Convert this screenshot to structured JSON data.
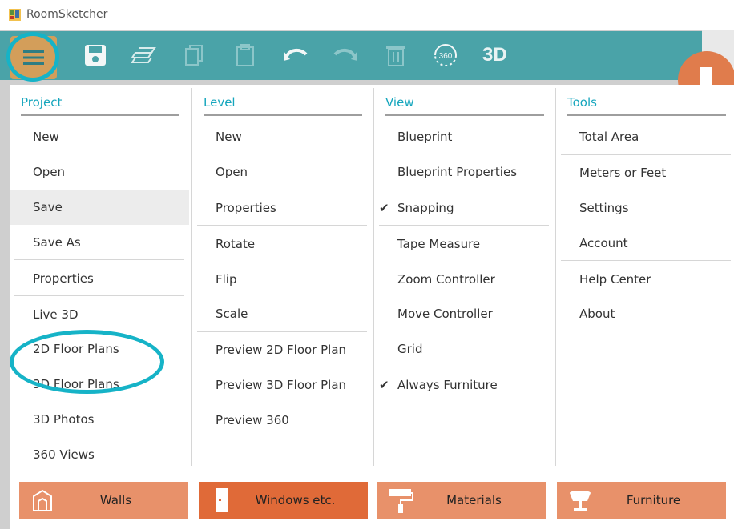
{
  "window": {
    "title": "RoomSketcher"
  },
  "toolbar": {
    "menu_icon": "hamburger-menu-icon",
    "save_icon": "floppy-save-icon",
    "layers_icon": "layers-icon",
    "copy_icon": "copy-icon",
    "paste_icon": "clipboard-paste-icon",
    "undo_icon": "undo-arrow-icon",
    "redo_icon": "redo-arrow-icon",
    "delete_icon": "trash-icon",
    "rotate360_label": "360",
    "view3d_label": "3D",
    "accent_color": "#4aa3a8",
    "menu_button_color": "#d39e5a"
  },
  "menu": {
    "project": {
      "header": "Project",
      "items": [
        "New",
        "Open",
        "Save",
        "Save As",
        "Properties",
        "Live 3D",
        "2D Floor Plans",
        "3D Floor Plans",
        "3D Photos",
        "360 Views"
      ],
      "selected": "Save"
    },
    "level": {
      "header": "Level",
      "items": [
        "New",
        "Open",
        "Properties",
        "Rotate",
        "Flip",
        "Scale",
        "Preview 2D Floor Plan",
        "Preview 3D Floor Plan",
        "Preview 360"
      ]
    },
    "view": {
      "header": "View",
      "items": [
        "Blueprint",
        "Blueprint Properties",
        "Snapping",
        "Tape Measure",
        "Zoom Controller",
        "Move Controller",
        "Grid",
        "Always Furniture"
      ],
      "checked": [
        "Snapping",
        "Always Furniture"
      ],
      "check_glyph": "✔"
    },
    "tools": {
      "header": "Tools",
      "items": [
        "Total Area",
        "Meters or Feet",
        "Settings",
        "Account",
        "Help Center",
        "About"
      ]
    },
    "header_color": "#16a6bd"
  },
  "bottom_tabs": [
    {
      "label": "Walls",
      "icon": "walls-icon",
      "color": "#e8916a"
    },
    {
      "label": "Windows etc.",
      "icon": "door-icon",
      "color": "#e06a38"
    },
    {
      "label": "Materials",
      "icon": "paint-roller-icon",
      "color": "#e8916a"
    },
    {
      "label": "Furniture",
      "icon": "chair-icon",
      "color": "#e8916a"
    }
  ]
}
